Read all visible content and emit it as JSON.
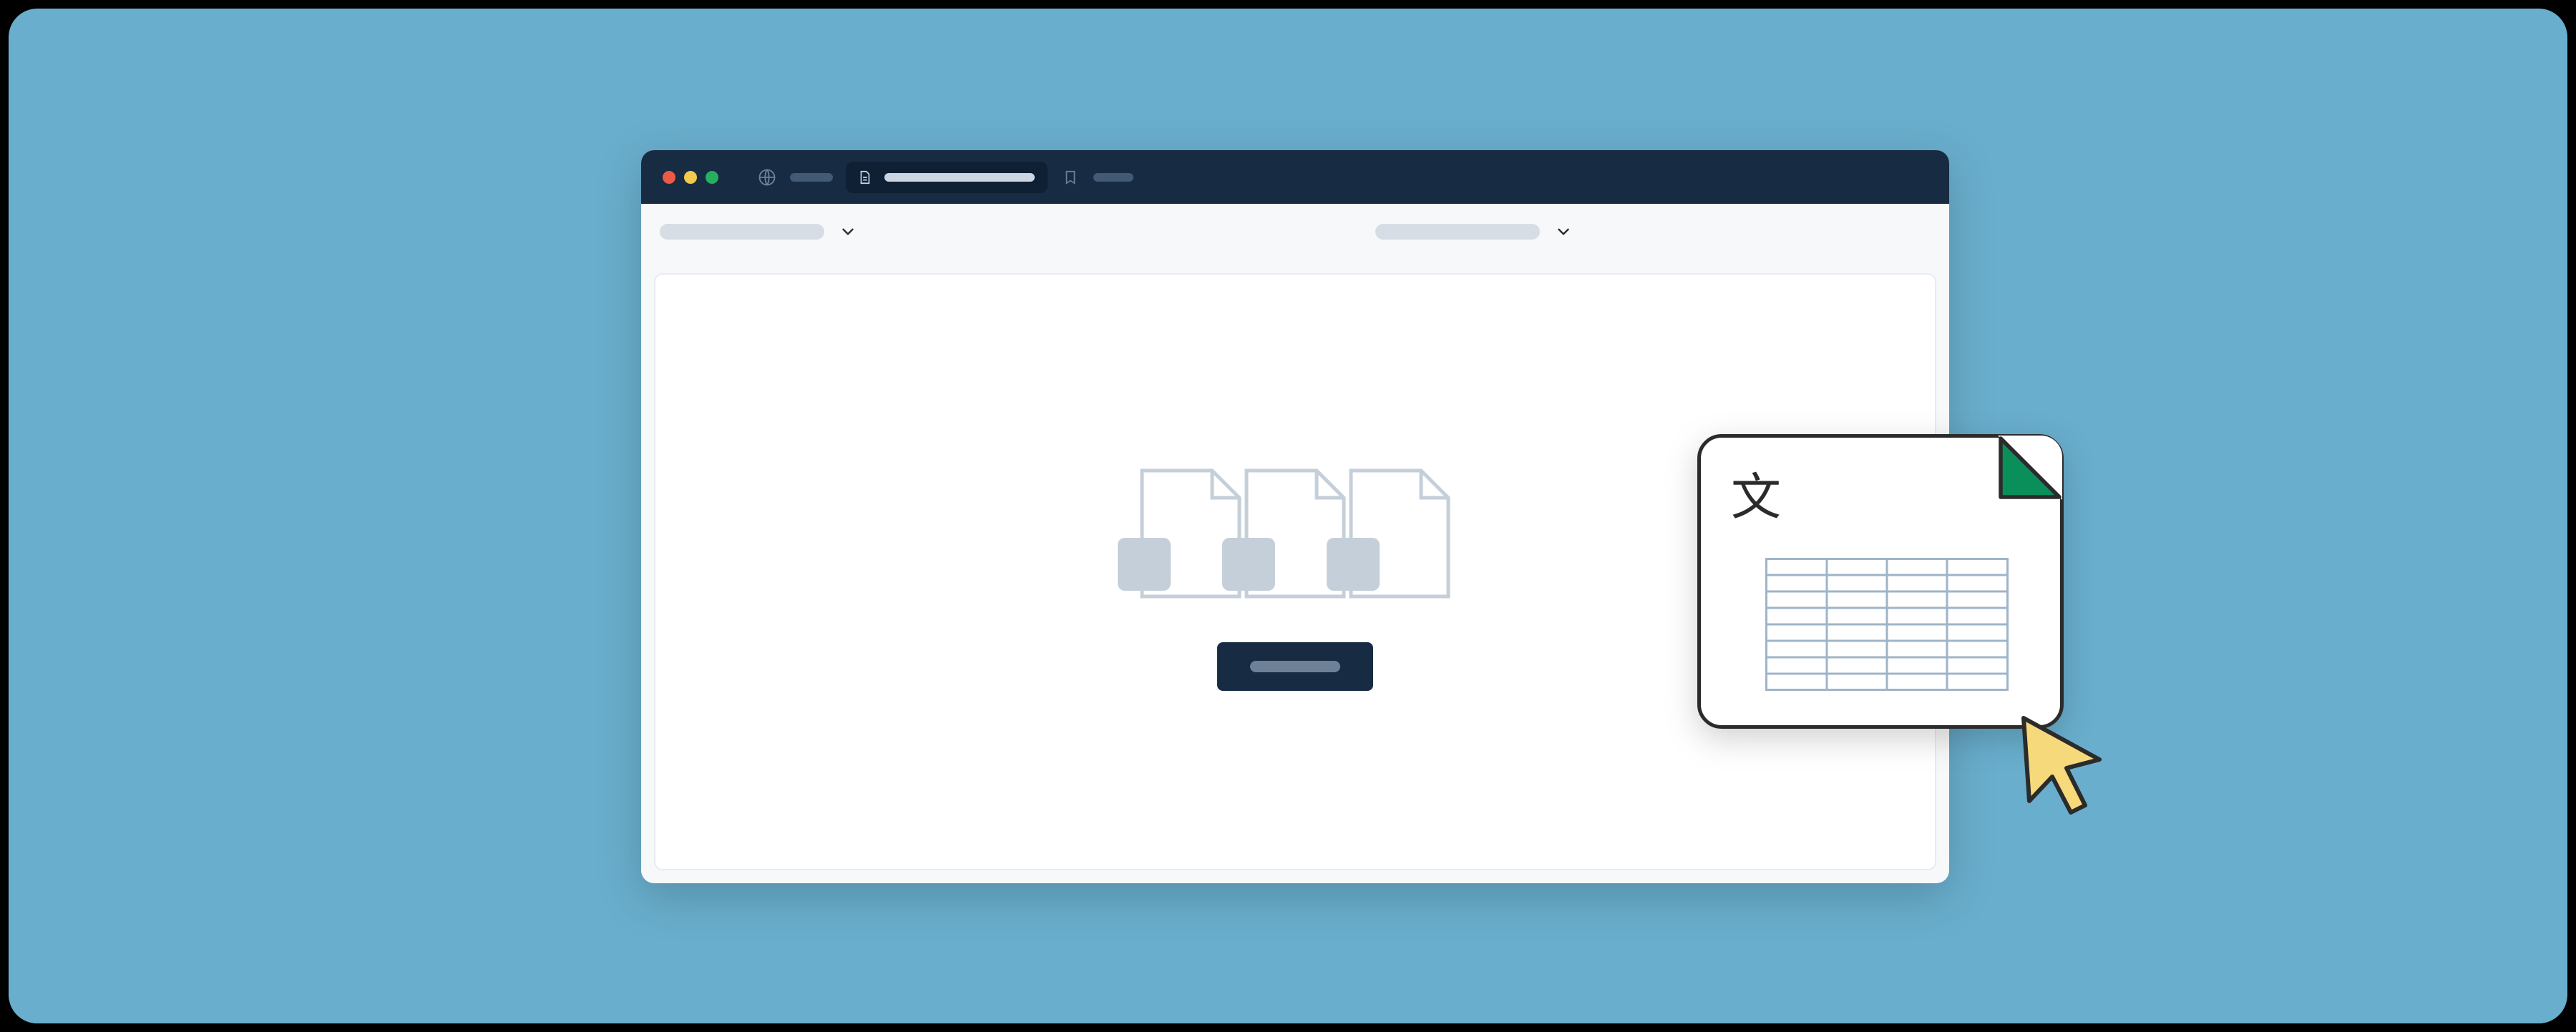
{
  "illustration": {
    "traffic_lights": [
      "red",
      "yellow",
      "green"
    ],
    "titlebar": {
      "globe_icon": "globe-icon",
      "page_icon": "document-icon",
      "bookmark_icon": "bookmark-icon"
    },
    "toolbar_dropdowns": 2,
    "content": {
      "placeholder_docs": 3,
      "primary_button": true
    },
    "overlay_document": {
      "glyph": "文",
      "type": "spreadsheet",
      "fold_color": "#0a8f5b"
    },
    "cursor_color": "#f5d97a"
  }
}
